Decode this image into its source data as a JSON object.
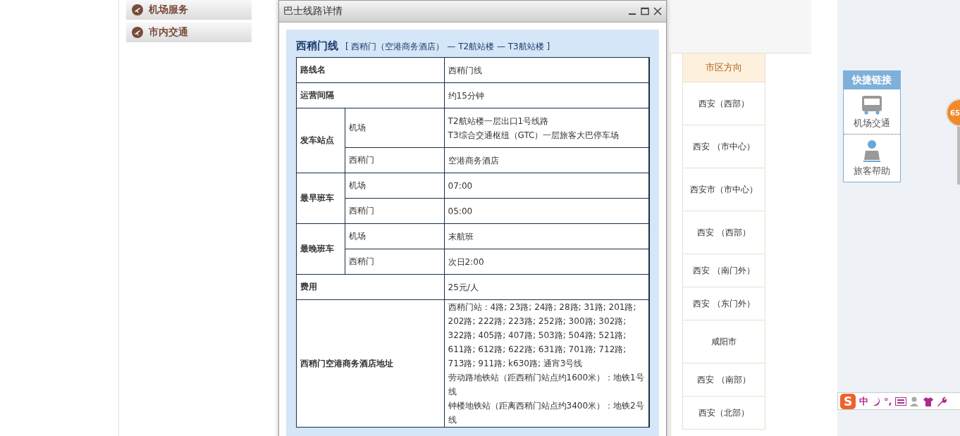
{
  "sidebar": {
    "items": [
      {
        "label": "机场服务"
      },
      {
        "label": "市内交通"
      }
    ]
  },
  "background_table": {
    "header": "市区方向",
    "cells": [
      "西安（西部）",
      "西安 （市中心）",
      "西安市（市中心）",
      "西安 （西部）",
      "西安 （南门外）",
      "西安 （东门外）",
      "咸阳市",
      "西安 （南部）",
      "西安（北部）"
    ]
  },
  "quick_links": {
    "title": "快捷链接",
    "items": [
      {
        "kind": "bus",
        "label": "机场交通"
      },
      {
        "kind": "helper",
        "label": "旅客帮助"
      }
    ]
  },
  "badge": "65",
  "ime_toolbar": {
    "logo": "S",
    "mode": "中",
    "punct": "°,"
  },
  "dialog": {
    "title": "巴士线路详情",
    "route_name": "西稍门线",
    "route_path": "[ 西稍门（空港商务酒店） — T2航站楼 — T3航站楼 ]",
    "rows": [
      {
        "kind": "single",
        "label": "路线名",
        "lines": [
          "西稍门线"
        ]
      },
      {
        "kind": "single",
        "label": "运营间隔",
        "lines": [
          "约15分钟"
        ]
      },
      {
        "kind": "group",
        "label": "发车站点",
        "subrows": [
          {
            "label": "机场",
            "lines": [
              "T2航站楼一层出口1号线路",
              "T3综合交通枢纽（GTC）一层旅客大巴停车场"
            ]
          },
          {
            "label": "西稍门",
            "lines": [
              "空港商务酒店"
            ]
          }
        ]
      },
      {
        "kind": "group",
        "label": "最早班车",
        "subrows": [
          {
            "label": "机场",
            "lines": [
              "07:00"
            ]
          },
          {
            "label": "西稍门",
            "lines": [
              "05:00"
            ]
          }
        ]
      },
      {
        "kind": "group",
        "label": "最晚班车",
        "subrows": [
          {
            "label": "机场",
            "lines": [
              "末航班"
            ]
          },
          {
            "label": "西稍门",
            "lines": [
              "次日2:00"
            ]
          }
        ]
      },
      {
        "kind": "single",
        "label": "费用",
        "lines": [
          "25元/人"
        ]
      },
      {
        "kind": "single",
        "label": "西稍门空港商务酒店地址",
        "lines": [
          "西稍门站：4路; 23路; 24路; 28路; 31路; 201路; 202路; 222路; 223路; 252路; 300路; 302路; 322路; 405路; 407路; 503路; 504路; 521路; 611路; 612路; 622路; 631路; 701路; 712路; 713路; 911路; k630路; 通宵3号线",
          "劳动路地铁站（距西稍门站点约1600米）：地铁1号线",
          "钟楼地铁站（距离西稍门站点约3400米）：地铁2号线"
        ]
      }
    ]
  }
}
